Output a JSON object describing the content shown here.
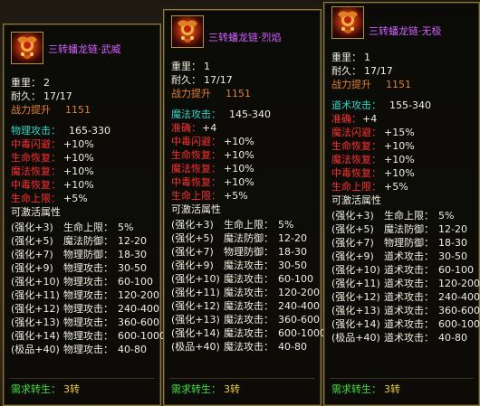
{
  "panels": [
    {
      "title": "三转蟠龙链·武威",
      "weight_label": "重里：",
      "weight_value": "2",
      "durability_label": "耐久：",
      "durability_value": "17/17",
      "power_label": "战力提升",
      "power_value": "1151",
      "main_stat_label": "物理攻击：",
      "main_stat_value": "165-330",
      "accuracy": null,
      "bonus": [
        {
          "label": "中毒闪避：",
          "value": "+10%"
        },
        {
          "label": "生命恢复：",
          "value": "+10%"
        },
        {
          "label": "魔法恢复：",
          "value": "+10%"
        },
        {
          "label": "中毒恢复：",
          "value": "+10%"
        },
        {
          "label": "生命上限：",
          "value": "+5%"
        }
      ],
      "activatable_label": "可激活属性",
      "enhance": [
        {
          "level": "(强化+3)",
          "stat": "生命上限：",
          "value": "5%"
        },
        {
          "level": "(强化+5)",
          "stat": "魔法防御：",
          "value": "12-20"
        },
        {
          "level": "(强化+7)",
          "stat": "物理防御：",
          "value": "18-30"
        },
        {
          "level": "(强化+9)",
          "stat": "物理攻击：",
          "value": "30-50"
        },
        {
          "level": "(强化+10)",
          "stat": "物理攻击：",
          "value": "60-100"
        },
        {
          "level": "(强化+11)",
          "stat": "物理攻击：",
          "value": "120-200"
        },
        {
          "level": "(强化+12)",
          "stat": "物理攻击：",
          "value": "240-400"
        },
        {
          "level": "(强化+13)",
          "stat": "物理攻击：",
          "value": "360-600"
        },
        {
          "level": "(强化+14)",
          "stat": "物理攻击：",
          "value": "600-1000"
        },
        {
          "level": "(极品+40)",
          "stat": "物理攻击：",
          "value": "40-80"
        }
      ],
      "require_label": "需求转生：",
      "require_value": "3转"
    },
    {
      "title": "三转蟠龙链·烈焰",
      "weight_label": "重里：",
      "weight_value": "1",
      "durability_label": "耐久：",
      "durability_value": "17/17",
      "power_label": "战力提升",
      "power_value": "1151",
      "main_stat_label": "魔法攻击：",
      "main_stat_value": "145-340",
      "accuracy": {
        "label": "准确：",
        "value": "+4"
      },
      "bonus": [
        {
          "label": "中毒闪避：",
          "value": "+10%"
        },
        {
          "label": "生命恢复：",
          "value": "+10%"
        },
        {
          "label": "魔法恢复：",
          "value": "+10%"
        },
        {
          "label": "中毒恢复：",
          "value": "+10%"
        },
        {
          "label": "生命上限：",
          "value": "+5%"
        }
      ],
      "activatable_label": "可激活属性",
      "enhance": [
        {
          "level": "(强化+3)",
          "stat": "生命上限：",
          "value": "5%"
        },
        {
          "level": "(强化+5)",
          "stat": "魔法防御：",
          "value": "12-20"
        },
        {
          "level": "(强化+7)",
          "stat": "物理防御：",
          "value": "18-30"
        },
        {
          "level": "(强化+9)",
          "stat": "魔法攻击：",
          "value": "30-50"
        },
        {
          "level": "(强化+10)",
          "stat": "魔法攻击：",
          "value": "60-100"
        },
        {
          "level": "(强化+11)",
          "stat": "魔法攻击：",
          "value": "120-200"
        },
        {
          "level": "(强化+12)",
          "stat": "魔法攻击：",
          "value": "240-400"
        },
        {
          "level": "(强化+13)",
          "stat": "魔法攻击：",
          "value": "360-600"
        },
        {
          "level": "(强化+14)",
          "stat": "魔法攻击：",
          "value": "600-1000"
        },
        {
          "level": "(极品+40)",
          "stat": "魔法攻击：",
          "value": "40-80"
        }
      ],
      "require_label": "需求转生：",
      "require_value": "3转"
    },
    {
      "title": "三转蟠龙链·无极",
      "weight_label": "重里：",
      "weight_value": "1",
      "durability_label": "耐久：",
      "durability_value": "17/17",
      "power_label": "战力提升",
      "power_value": "1151",
      "main_stat_label": "道术攻击：",
      "main_stat_value": "155-340",
      "accuracy": {
        "label": "准确：",
        "value": "+4"
      },
      "bonus": [
        {
          "label": "魔法闪避：",
          "value": "+15%"
        },
        {
          "label": "生命恢复：",
          "value": "+10%"
        },
        {
          "label": "魔法恢复：",
          "value": "+10%"
        },
        {
          "label": "中毒恢复：",
          "value": "+10%"
        },
        {
          "label": "生命上限：",
          "value": "+5%"
        }
      ],
      "activatable_label": "可激活属性",
      "enhance": [
        {
          "level": "(强化+3)",
          "stat": "生命上限：",
          "value": "5%"
        },
        {
          "level": "(强化+5)",
          "stat": "魔法防御：",
          "value": "12-20"
        },
        {
          "level": "(强化+7)",
          "stat": "物理防御：",
          "value": "18-30"
        },
        {
          "level": "(强化+9)",
          "stat": "道术攻击：",
          "value": "30-50"
        },
        {
          "level": "(强化+10)",
          "stat": "道术攻击：",
          "value": "60-100"
        },
        {
          "level": "(强化+11)",
          "stat": "道术攻击：",
          "value": "120-200"
        },
        {
          "level": "(强化+12)",
          "stat": "道术攻击：",
          "value": "240-400"
        },
        {
          "level": "(强化+13)",
          "stat": "道术攻击：",
          "value": "360-600"
        },
        {
          "level": "(强化+14)",
          "stat": "道术攻击：",
          "value": "600-1000"
        },
        {
          "level": "(极品+40)",
          "stat": "道术攻击：",
          "value": "40-80"
        }
      ],
      "require_label": "需求转生：",
      "require_value": "3转"
    }
  ],
  "colors": {
    "title": "#d060ff",
    "power_value": "#e08030",
    "main_stat": "#30d8c8",
    "bonus_label": "#ff3030",
    "require": "#40e040",
    "border": "#8b7a3e"
  },
  "icon_name": "dragon-necklace-icon"
}
